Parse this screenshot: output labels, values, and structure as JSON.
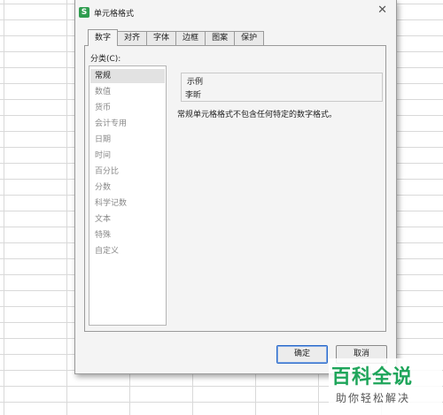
{
  "dialog": {
    "title": "单元格格式",
    "app_icon_glyph": "S",
    "close_glyph": "✕"
  },
  "tabs": [
    {
      "label": "数字",
      "active": true
    },
    {
      "label": "对齐"
    },
    {
      "label": "字体"
    },
    {
      "label": "边框"
    },
    {
      "label": "图案"
    },
    {
      "label": "保护"
    }
  ],
  "category": {
    "label": "分类(C):",
    "items": [
      "常规",
      "数值",
      "货币",
      "会计专用",
      "日期",
      "时间",
      "百分比",
      "分数",
      "科学记数",
      "文本",
      "特殊",
      "自定义"
    ],
    "selected": "常规"
  },
  "sample": {
    "label": "示例",
    "value": "李昕"
  },
  "description": "常规单元格格式不包含任何特定的数字格式。",
  "buttons": {
    "ok": "确定",
    "cancel": "取消"
  },
  "annotation": {
    "color": "#d92c2c"
  },
  "watermark": {
    "main": "百科全说",
    "sub": "助你轻松解决"
  },
  "colors": {
    "accent_green": "#1ea55a",
    "highlight_red": "#d92c2c"
  }
}
